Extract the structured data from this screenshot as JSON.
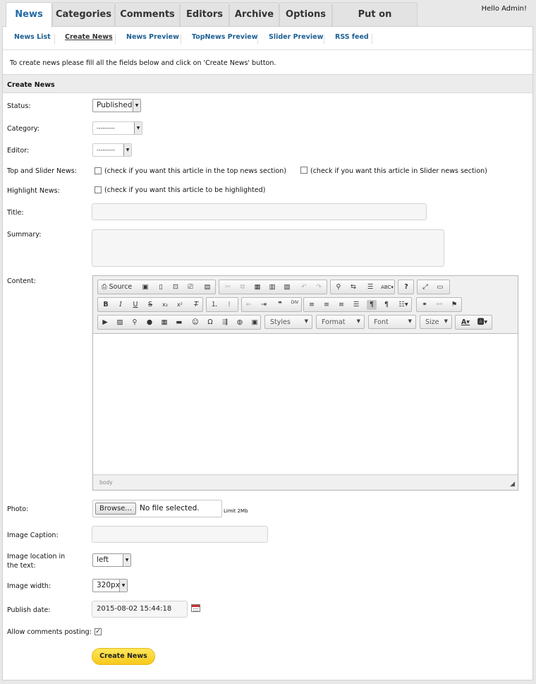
{
  "tabs": [
    "News",
    "Categories",
    "Comments",
    "Editors",
    "Archive",
    "Options",
    "Put on WebPage"
  ],
  "greeting": "Hello Admin!",
  "subnav": [
    "News List",
    "Create News",
    "News Preview",
    "TopNews Preview",
    "Slider Preview",
    "RSS feed"
  ],
  "intro": "To create news please fill all the fields below and click on 'Create News' button.",
  "section_title": "Create News",
  "form": {
    "status_label": "Status:",
    "status_value": "Published",
    "category_label": "Category:",
    "category_value": "---------",
    "editor_label": "Editor:",
    "editor_value": "---------",
    "top_slider_label": "Top and Slider News:",
    "top_news_hint": "(check if you want this article in the top news section)",
    "slider_news_hint": "(check if you want this article in Slider news section)",
    "highlight_label": "Highlight News:",
    "highlight_hint": "(check if you want this article to be highlighted)",
    "title_label": "Title:",
    "title_value": "",
    "summary_label": "Summary:",
    "summary_value": "",
    "content_label": "Content:",
    "photo_label": "Photo:",
    "browse_label": "Browse...",
    "no_file": "No file selected.",
    "limit": "Limit 2Mb",
    "caption_label": "Image Caption:",
    "caption_value": "",
    "location_label": "Image location in the text:",
    "location_value": "left",
    "width_label": "Image width:",
    "width_value": "320px",
    "publish_label": "Publish date:",
    "publish_value": "2015-08-02 15:44:18",
    "comments_label": "Allow comments posting:",
    "comments_checked": true,
    "submit_label": "Create News"
  },
  "editor": {
    "source_label": "Source",
    "styles_label": "Styles",
    "format_label": "Format",
    "font_label": "Font",
    "size_label": "Size",
    "path": "body",
    "row1_icons": [
      "save-icon",
      "new-page-icon",
      "preview-icon",
      "print-icon",
      "templates-icon",
      "cut-icon",
      "copy-icon",
      "paste-icon",
      "paste-text-icon",
      "paste-word-icon",
      "undo-icon",
      "redo-icon",
      "find-icon",
      "replace-icon",
      "select-all-icon",
      "spellcheck-icon",
      "help-icon",
      "maximize-icon",
      "show-blocks-icon"
    ],
    "row2_icons": [
      "bold-icon",
      "italic-icon",
      "underline-icon",
      "strike-icon",
      "subscript-icon",
      "superscript-icon",
      "remove-format-icon",
      "numbered-list-icon",
      "bulleted-list-icon",
      "outdent-icon",
      "indent-icon",
      "blockquote-icon",
      "div-icon",
      "align-left-icon",
      "align-center-icon",
      "align-right-icon",
      "justify-icon",
      "ltr-icon",
      "rtl-icon",
      "language-icon",
      "link-icon",
      "unlink-icon",
      "anchor-icon"
    ],
    "row3_icons": [
      "youtube-icon",
      "image-icon",
      "zoom-icon",
      "flash-icon",
      "table-icon",
      "horizontal-rule-icon",
      "smiley-icon",
      "special-char-icon",
      "page-break-icon",
      "iframe-icon",
      "image-map-icon",
      "text-color-icon",
      "bg-color-icon"
    ]
  }
}
